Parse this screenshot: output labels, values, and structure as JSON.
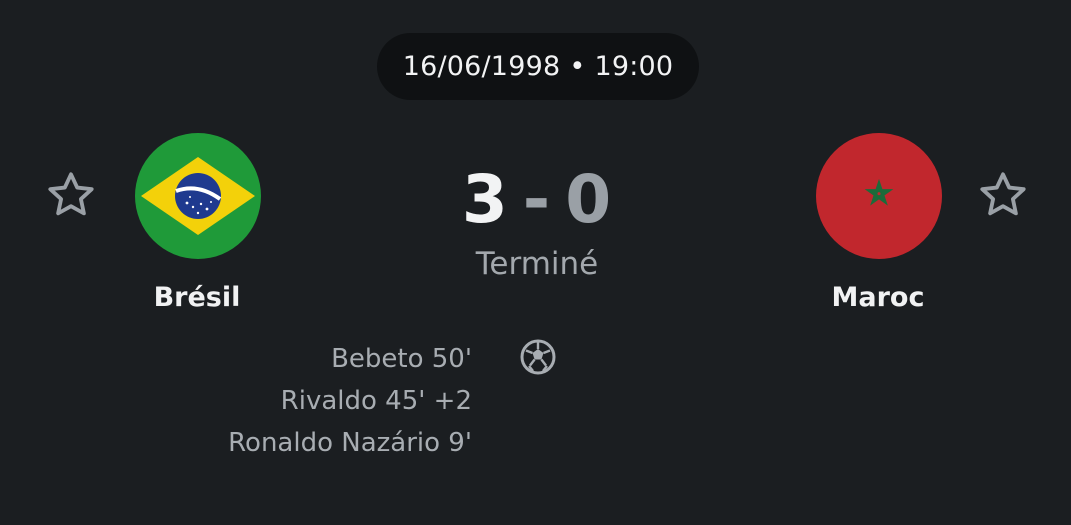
{
  "match": {
    "date": "16/06/1998",
    "separator": "•",
    "time": "19:00",
    "status": "Terminé"
  },
  "home_team": {
    "name": "Brésil",
    "score": "3",
    "flag_icon": "brazil-flag-icon",
    "favorite_icon": "star-outline-icon"
  },
  "away_team": {
    "name": "Maroc",
    "score": "0",
    "flag_icon": "morocco-flag-icon",
    "favorite_icon": "star-outline-icon"
  },
  "score_separator": "-",
  "events": {
    "icon": "soccer-ball-icon",
    "home_goals": [
      "Bebeto 50'",
      "Rivaldo 45' +2",
      "Ronaldo Nazário 9'"
    ]
  },
  "colors": {
    "background": "#1b1e21",
    "pill_background": "#0f1113",
    "primary_text": "#f2f3f4",
    "secondary_text": "#a3a8ad",
    "brazil_green": "#1f9a39",
    "brazil_yellow": "#f3d10a",
    "brazil_blue": "#1f3a8f",
    "morocco_red": "#c1272d",
    "morocco_green": "#1c6b3a"
  }
}
